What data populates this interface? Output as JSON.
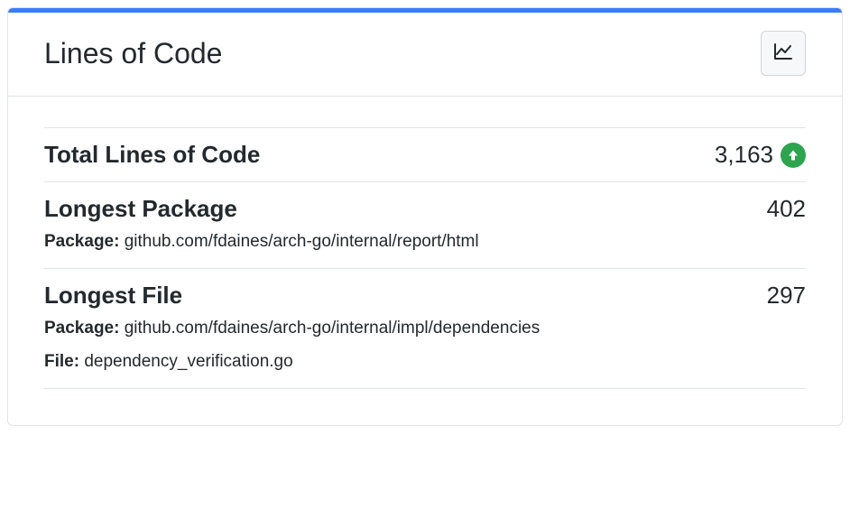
{
  "card": {
    "title": "Lines of Code"
  },
  "metrics": {
    "total": {
      "label": "Total Lines of Code",
      "value": "3,163",
      "trend": "up"
    },
    "longestPackage": {
      "label": "Longest Package",
      "value": "402",
      "packageKey": "Package:",
      "packageVal": "github.com/fdaines/arch-go/internal/report/html"
    },
    "longestFile": {
      "label": "Longest File",
      "value": "297",
      "packageKey": "Package:",
      "packageVal": "github.com/fdaines/arch-go/internal/impl/dependencies",
      "fileKey": "File:",
      "fileVal": "dependency_verification.go"
    }
  }
}
